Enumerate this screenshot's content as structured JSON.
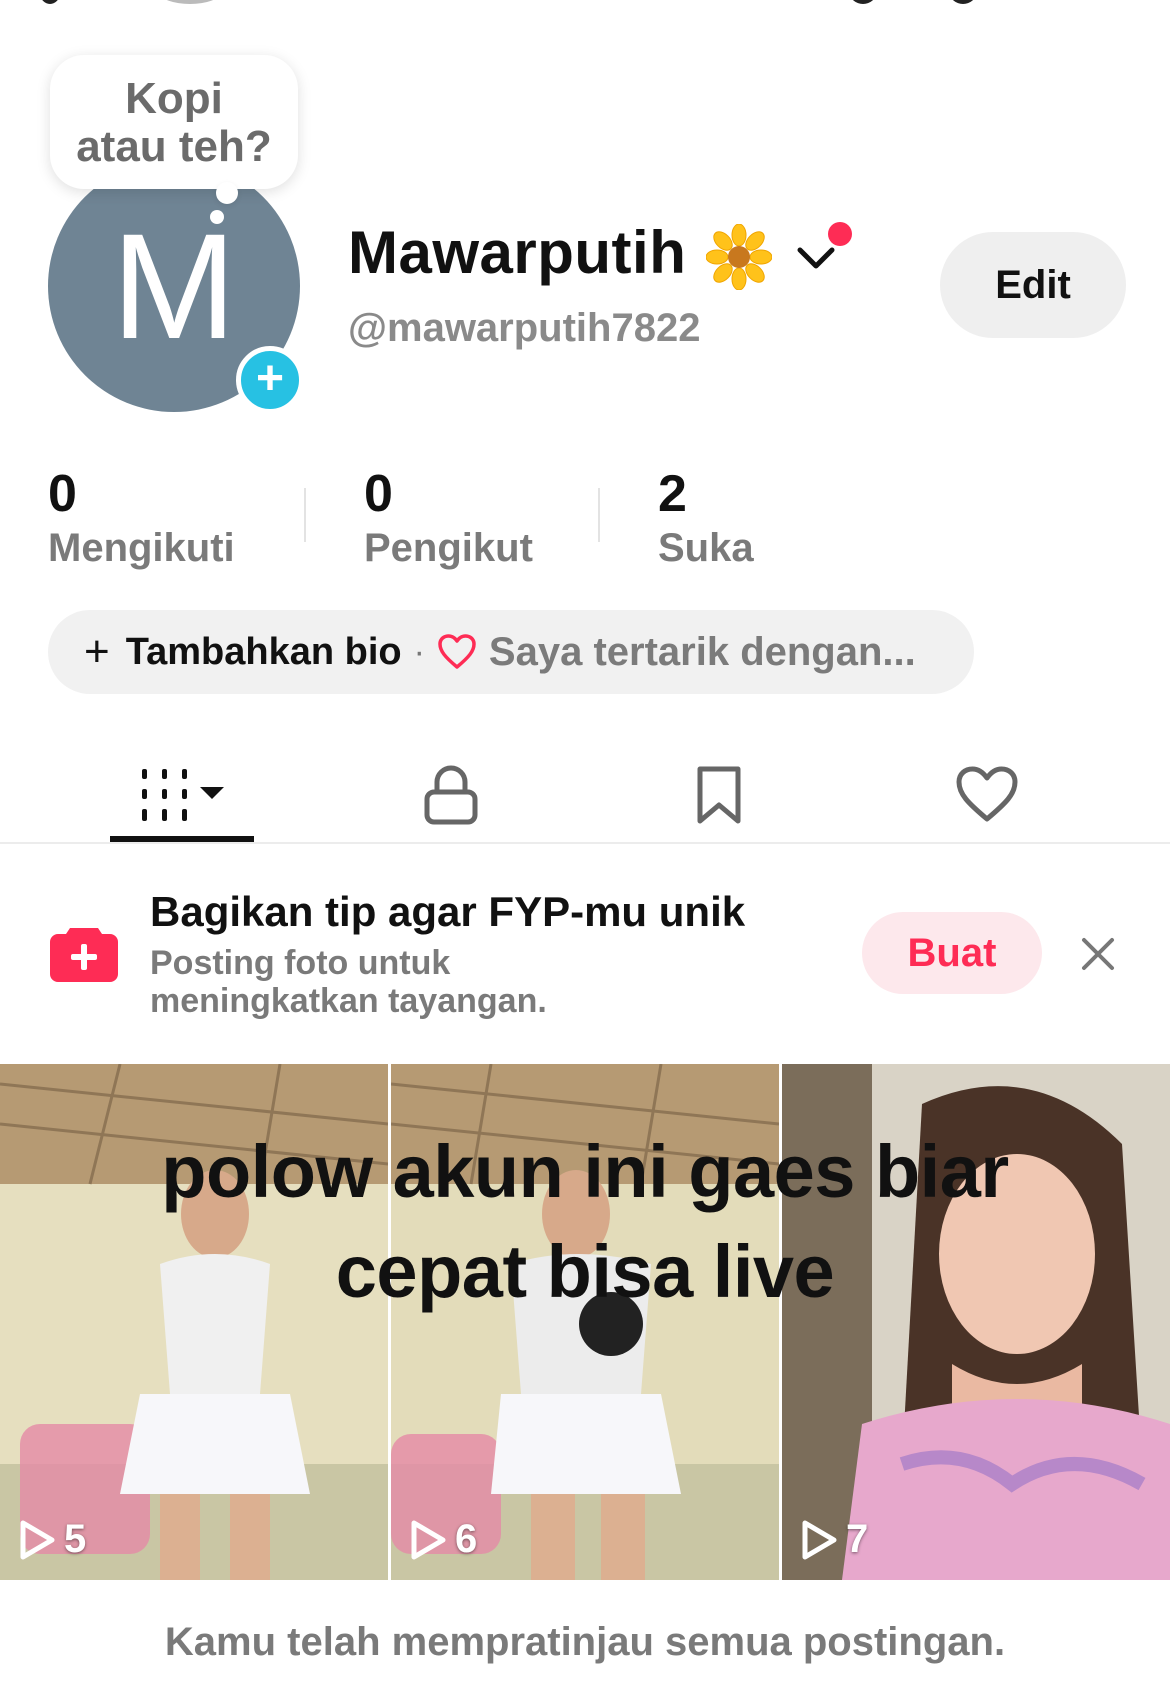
{
  "profile": {
    "bubble_line1": "Kopi",
    "bubble_line2": "atau teh?",
    "avatar_letter": "M",
    "display_name": "Mawarputih",
    "handle": "@mawarputih7822",
    "edit_label": "Edit"
  },
  "stats": [
    {
      "value": "0",
      "label": "Mengikuti"
    },
    {
      "value": "0",
      "label": "Pengikut"
    },
    {
      "value": "2",
      "label": "Suka"
    }
  ],
  "bio": {
    "add_label": "Tambahkan bio",
    "separator": "·",
    "interest_label": "Saya tertarik dengan..."
  },
  "tabs": [
    {
      "icon": "grid-icon",
      "active": true
    },
    {
      "icon": "lock-icon",
      "active": false
    },
    {
      "icon": "bookmark-icon",
      "active": false
    },
    {
      "icon": "heart-icon",
      "active": false
    }
  ],
  "promo": {
    "title": "Bagikan tip agar FYP-mu unik",
    "subtitle_line1": "Posting foto untuk",
    "subtitle_line2": "meningkatkan tayangan.",
    "button_label": "Buat"
  },
  "videos": {
    "overlay_line1": "polow akun ini gaes biar",
    "overlay_line2": "cepat bisa live",
    "items": [
      {
        "views": "5"
      },
      {
        "views": "6"
      },
      {
        "views": "7"
      }
    ]
  },
  "footer": {
    "note": "Kamu telah mempratinjau semua postingan."
  },
  "colors": {
    "accent": "#fe2c55",
    "avatar_bg": "#6f8494",
    "add_badge": "#27c1e3"
  }
}
